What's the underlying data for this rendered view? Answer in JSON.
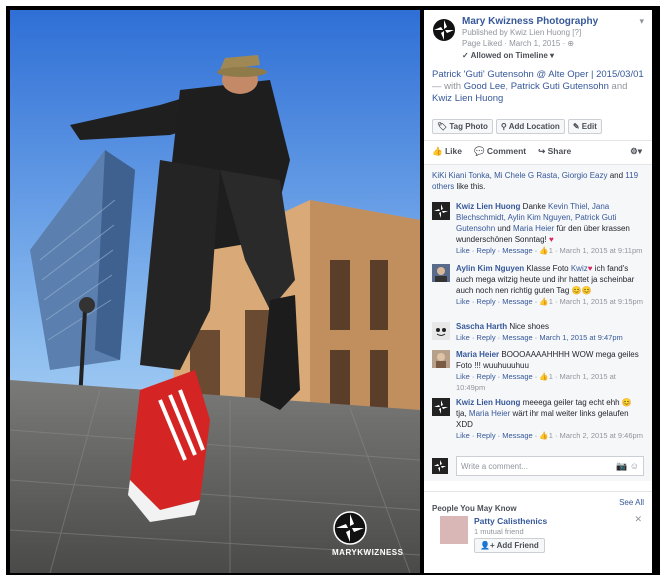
{
  "header": {
    "page_name": "Mary Kwizness Photography",
    "published_by": "Published by Kwiz Lien Huong [?]",
    "page_liked": "Page Liked · March 1, 2015 · ",
    "timeline": "Allowed on Timeline ▾"
  },
  "caption": {
    "title": "Patrick 'Guti' Gutensohn @ Alte Oper | 2015/03/01",
    "with_prefix": "— with ",
    "tag1": "Good Lee",
    "sep1": ", ",
    "tag2": "Patrick Guti Gutensohn",
    "sep2": " and ",
    "tag3": "Kwiz Lien Huong"
  },
  "tools": {
    "tag_photo": "Tag Photo",
    "add_location": "Add Location",
    "edit": "Edit"
  },
  "actions": {
    "like": "Like",
    "comment": "Comment",
    "share": "Share"
  },
  "likes": {
    "names": "KiKi Kiani Tonka, Mi Chele G Rasta, Giorgio Eazy",
    "and": " and ",
    "others": "119 others",
    "suffix": " like this."
  },
  "comments": [
    {
      "author": "Kwiz Lien Huong",
      "text_a": " Danke ",
      "link_a": "Kevin Thiel, Jana Blechschmidt, Aylin Kim Nguyen, Patrick Guti Gutensohn",
      "text_b": " und ",
      "link_b": "Maria Heier",
      "text_c": " für den über krassen wunderschönen Sonntag!",
      "emoji": "♥",
      "footer": "Like · Reply · Message · ",
      "like_count": "1",
      "date": " · March 1, 2015 at 9:11pm"
    },
    {
      "author": "Aylin Kim Nguyen",
      "text_a": " Klasse Foto ",
      "link_a": "Kwiz",
      "text_c": " ich fand's auch mega witzig heute und ihr hattet ja scheinbar auch noch nen richtig guten Tag ",
      "emoji": "😊😊",
      "footer": "Like · Reply · Message · ",
      "like_count": "1",
      "date": " · March 1, 2015 at 9:15pm"
    },
    {
      "author": "Sascha Harth",
      "text_a": " Nice shoes",
      "footer": "Like · Reply · Message · March 1, 2015 at 9:47pm"
    },
    {
      "author": "Maria Heier",
      "text_a": " BOOOAAAAHHHH WOW mega geiles Foto !!! wuuhuuuhuu",
      "footer": "Like · Reply · Message · ",
      "like_count": "1",
      "date": " · March 1, 2015 at 10:49pm"
    },
    {
      "author": "Kwiz Lien Huong",
      "text_a": " meeega geiler tag echt ehh ",
      "emoji": "😊",
      "text_b": " tja, ",
      "link_b": "Maria Heier",
      "text_c": " wärt ihr mal weiter links gelaufen XDD",
      "footer": "Like · Reply · Message · ",
      "like_count": "1",
      "date": " · March 2, 2015 at 9:46pm"
    }
  ],
  "write_placeholder": "Write a comment...",
  "pymk": {
    "title": "People You May Know",
    "see_all": "See All",
    "person": "Patty Calisthenics",
    "mutual": "1 mutual friend",
    "add_friend": "Add Friend"
  },
  "watermark": "MARYKWIZNESS"
}
